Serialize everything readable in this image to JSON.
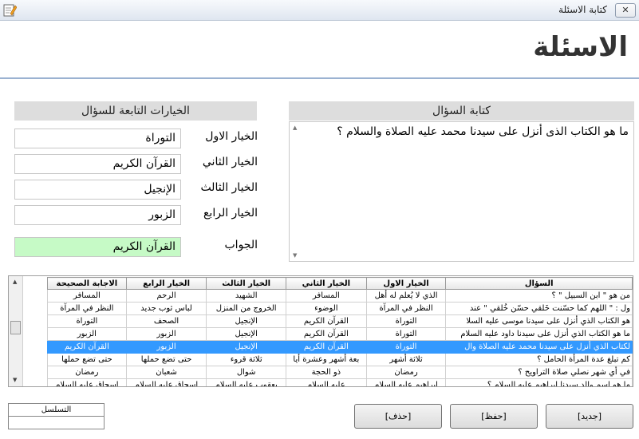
{
  "window": {
    "title": "كتابة الاسئلة",
    "close_glyph": "✕",
    "app_icon": "pencil-note-icon"
  },
  "header": {
    "heading": "الاسئلة"
  },
  "question_panel": {
    "title": "كتابة السؤال",
    "text": "ما هو الكتاب الذى أنزل على سيدنا محمد عليه الصلاة والسلام ؟"
  },
  "options_panel": {
    "title": "الخيارات التابعة للسؤال",
    "option1": {
      "label": "الخيار الاول",
      "value": "التوراة"
    },
    "option2": {
      "label": "الخيار الثاني",
      "value": "القرآن الكريم"
    },
    "option3": {
      "label": "الخيار الثالث",
      "value": "الإنجيل"
    },
    "option4": {
      "label": "الخيار الرابع",
      "value": "الزبور"
    },
    "answer": {
      "label": "الجواب",
      "value": "القرآن الكريم"
    }
  },
  "grid": {
    "columns": [
      "السؤال",
      "الخيار الاول",
      "الخيار الثاني",
      "الخيار الثالث",
      "الخيار الرابع",
      "الاجابة الصحيحة"
    ],
    "rows": [
      [
        "من هو \" ابن السبيل \" ؟",
        "الذي لا يُعلم له أهل",
        "المسافر",
        "الشهيد",
        "الرحم",
        "المسافر"
      ],
      [
        "ول : \" اللهم كما حسّنت خَلقي حسّن خُلقي \" عند",
        "النظر في المرآة",
        "الوضوء",
        "الخروج من المنزل",
        "لباس ثوب جديد",
        "النظر في المرآة"
      ],
      [
        "هو الكتاب الذي أنزل على سيدنا موسى عليه السلا",
        "التوراة",
        "القرآن الكريم",
        "الإنجيل",
        "الصحف",
        "التوراة"
      ],
      [
        "ما هو الكتاب الذي أنزل على سيدنا داود عليه السلام",
        "التوراة",
        "القرآن الكريم",
        "الإنجيل",
        "الزبور",
        "الزبور"
      ],
      [
        "لكتاب الذي أنزل على سيدنا محمد عليه الصلاة وال",
        "التوراة",
        "القرآن الكريم",
        "الإنجيل",
        "الزبور",
        "القرآن الكريم"
      ],
      [
        "كم تبلغ عدة المرأة الحامل ؟",
        "ثلاثة أشهر",
        "بعة أشهر وعشرة أيا",
        "ثلاثة قروء",
        "حتى تضع حملها",
        "حتى تضع حملها"
      ],
      [
        "في أي شهر نصلي صلاة التراويح ؟",
        "رمضان",
        "ذو الحجة",
        "شوال",
        "شعبان",
        "رمضان"
      ],
      [
        "ما هو اسم والد سيدنا إبراهيم عليه السلام ؟",
        "إبراهيم عليه السلام",
        "عليه السلام",
        "يعقوب عليه السلام",
        "إسحاق عليه السلام",
        "إسحاق عليه السلام"
      ]
    ],
    "selected_index": 4
  },
  "counter": {
    "label": "التسلسل",
    "value": ""
  },
  "buttons": {
    "new": "[جديد]",
    "save": "[حفظ]",
    "delete": "[حذف]"
  }
}
